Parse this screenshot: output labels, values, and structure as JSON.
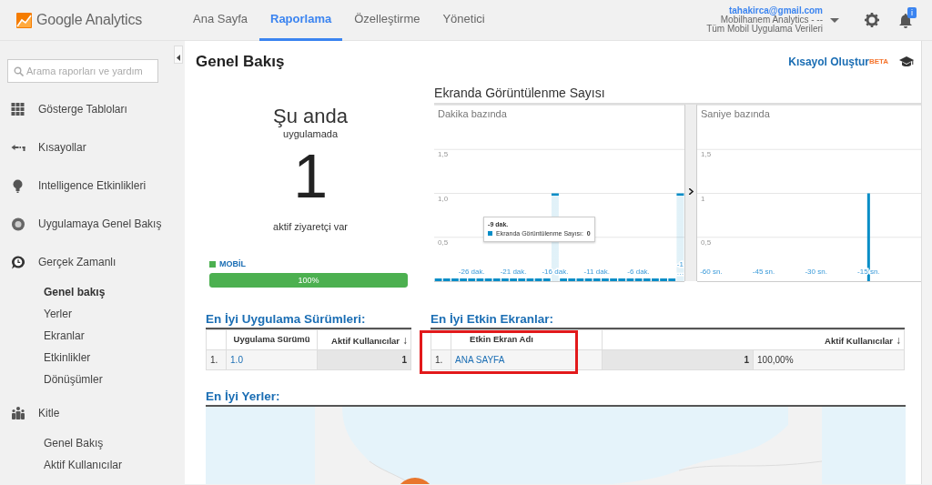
{
  "header": {
    "logo_text": "Google Analytics",
    "nav": [
      {
        "label": "Ana Sayfa",
        "selected": false
      },
      {
        "label": "Raporlama",
        "selected": true
      },
      {
        "label": "Özelleştirme",
        "selected": false
      },
      {
        "label": "Yönetici",
        "selected": false
      }
    ],
    "account": {
      "email": "tahakirca@gmail.com",
      "property": "Mobilhanem Analytics - --",
      "view": "Tüm Mobil Uygulama Verileri"
    },
    "notification_badge": "i"
  },
  "sidebar": {
    "search_placeholder": "Arama raporları ve yardım",
    "items": [
      {
        "label": "Gösterge Tabloları"
      },
      {
        "label": "Kısayollar"
      },
      {
        "label": "Intelligence Etkinlikleri"
      },
      {
        "label": "Uygulamaya Genel Bakış"
      },
      {
        "label": "Gerçek Zamanlı",
        "children": [
          {
            "label": "Genel bakış",
            "selected": true
          },
          {
            "label": "Yerler",
            "selected": false
          },
          {
            "label": "Ekranlar",
            "selected": false
          },
          {
            "label": "Etkinlikler",
            "selected": false
          },
          {
            "label": "Dönüşümler",
            "selected": false
          }
        ]
      },
      {
        "label": "Kitle",
        "children": [
          {
            "label": "Genel Bakış",
            "selected": false
          },
          {
            "label": "Aktif Kullanıcılar",
            "selected": false
          }
        ]
      }
    ]
  },
  "main": {
    "title": "Genel Bakış",
    "shortcut": "Kısayol Oluştur",
    "shortcut_badge": "BETA",
    "realtime": {
      "heading": "Şu anda",
      "subheading": "uygulamada",
      "count": "1",
      "caption": "aktif ziyaretçi var",
      "segments": [
        {
          "label": "MOBİL",
          "color": "#4cb050",
          "level": 1,
          "reading": "100%"
        }
      ]
    },
    "pageviews": {
      "title": "Ekranda Görüntülenme Sayısı",
      "charts": [
        {
          "kind": "minutes",
          "subtitle": "Dakika bazında",
          "chart_data": {
            "type": "bar",
            "x": [
              -30,
              -29,
              -28,
              -27,
              -26,
              -25,
              -24,
              -23,
              -22,
              -21,
              -20,
              -19,
              -18,
              -17,
              -16,
              -15,
              -14,
              -13,
              -12,
              -11,
              -10,
              -9,
              -8,
              -7,
              -6,
              -5,
              -4,
              -3,
              -2,
              -1
            ],
            "series": [
              {
                "color": "#058dc7",
                "values": [
                  0,
                  0,
                  0,
                  0,
                  0,
                  0,
                  0,
                  0,
                  0,
                  0,
                  0,
                  0,
                  0,
                  0,
                  1,
                  0,
                  0,
                  0,
                  0,
                  0,
                  0,
                  0,
                  0,
                  0,
                  0,
                  0,
                  0,
                  0,
                  0,
                  1
                ]
              }
            ],
            "xlim": [
              -30.5,
              -0.5
            ],
            "ylim": [
              0,
              2
            ],
            "grid": true,
            "xticks": [
              {
                "value": -26,
                "label": "-26 dak."
              },
              {
                "value": -21,
                "label": "-21 dak."
              },
              {
                "value": -16,
                "label": "-16 dak."
              },
              {
                "value": -11,
                "label": "-11 dak."
              },
              {
                "value": -6,
                "label": "-6 dak."
              },
              {
                "value": -1,
                "label": "-1 …"
              }
            ],
            "yticks": [
              {
                "value": 0.5,
                "label": "0,5"
              },
              {
                "value": 1,
                "label": "1,0"
              },
              {
                "value": 1.5,
                "label": "1,5"
              }
            ]
          },
          "tooltip": {
            "title": "-9 dak.",
            "label": "Ekranda Görüntülenme Sayısı:",
            "value": "0"
          }
        },
        {
          "kind": "seconds",
          "subtitle": "Saniye bazında",
          "chart_data": {
            "type": "bar",
            "x": [
              -15
            ],
            "series": [
              {
                "color": "#058dc7",
                "values": [
                  1
                ]
              }
            ],
            "xlim": [
              -64,
              0
            ],
            "ylim": [
              0,
              2
            ],
            "grid": true,
            "xticks": [
              {
                "value": -60,
                "label": "-60 sn."
              },
              {
                "value": -45,
                "label": "-45 sn."
              },
              {
                "value": -30,
                "label": "-30 sn."
              },
              {
                "value": -15,
                "label": "-15 sn."
              }
            ],
            "yticks": [
              {
                "value": 0.5,
                "label": "0,5"
              },
              {
                "value": 1,
                "label": "1"
              },
              {
                "value": 1.5,
                "label": "1,5"
              }
            ]
          }
        }
      ]
    },
    "versions": {
      "title": "En İyi Uygulama Sürümleri:",
      "columns": [
        {
          "label": "Uygulama Sürümü"
        },
        {
          "label": "Aktif Kullanıcılar",
          "sort": "↓"
        }
      ],
      "rows": [
        {
          "index": "1.",
          "version": "1.0",
          "users": "1"
        }
      ]
    },
    "screens": {
      "title": "En İyi Etkin Ekranlar:",
      "highlighted": true,
      "columns": [
        {
          "label": "Etkin Ekran Adı"
        },
        {
          "label": "Aktif Kullanıcılar",
          "sort": "↓"
        }
      ],
      "rows": [
        {
          "index": "1.",
          "name": "ANA SAYFA",
          "users": "1",
          "share": "100,00%"
        }
      ]
    },
    "places": {
      "title": "En İyi Yerler:"
    }
  }
}
